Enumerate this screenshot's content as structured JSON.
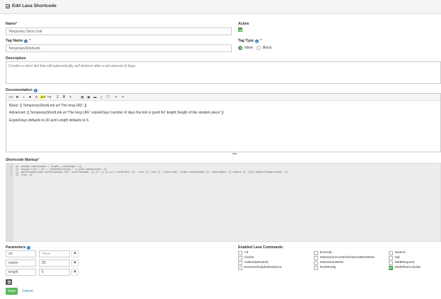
{
  "header": {
    "title": "Edit Lava Shortcode"
  },
  "name": {
    "label": "Name",
    "value": "Temporary Short Link"
  },
  "active": {
    "label": "Active",
    "checked": true
  },
  "tag_name": {
    "label": "Tag Name",
    "value": "TemporaryShortLink"
  },
  "tag_type": {
    "label": "Tag Type",
    "options": [
      "Inline",
      "Block"
    ],
    "selected": "Inline"
  },
  "description": {
    "label": "Description",
    "value": "Creates a short link that will automatically self destruct after a set amount of days."
  },
  "documentation": {
    "label": "Documentation",
    "toolbar": [
      "code-view-icon",
      "bold-icon",
      "italic-icon",
      "strikethrough-icon",
      "link-icon",
      "highlight-color-icon",
      "font-color-icon",
      "unordered-list-icon",
      "ordered-list-icon",
      "clear-format-icon",
      "table-icon",
      "image-icon",
      "folder-icon",
      "file-icon",
      "copy-icon",
      "undo-icon",
      "redo-icon"
    ],
    "lines": [
      "Basic: {[ TemporaryShortLink url:'The long URL' ]}",
      "Advanced: {[ TemporaryShortLink url:'The long URL' expireDays:'number of days the link is good for' length:'length of the random piece' ]}",
      "ExpireDays defaults to 30 and Length defaults to 5."
    ]
  },
  "markup": {
    "label": "Shortcode Markup",
    "line_numbers": [
      "1",
      "2",
      "3",
      "4"
    ],
    "lines": [
      "{%- assign tokenLength = length | AsInteger -%}",
      "{%- assign link = url | CreateShortLink:'',4,true,tokenLength -%}",
      "{{- workflowactivate workflowtype:'015' workflowname:'{{ url }} {{ url:'LocalPath' }}' link:'{{ link }}' linkstring | Right:tokenLength }}' expireDays:'{{ expire }}' %}{% endworkflowactivate -%}",
      "{{- link -}}"
    ]
  },
  "parameters": {
    "label": "Parameters",
    "rows": [
      {
        "key": "url",
        "value": "",
        "value_placeholder": "Value"
      },
      {
        "key": "expire",
        "value": "30",
        "value_placeholder": "Value"
      },
      {
        "key": "length",
        "value": "5",
        "value_placeholder": "Value"
      }
    ]
  },
  "commands": {
    "label": "Enabled Lava Commands",
    "col1": [
      {
        "name": "All",
        "checked": false
      },
      {
        "name": "Cache",
        "checked": false
      },
      {
        "name": "CalendarEvents",
        "checked": false
      },
      {
        "name": "EventScheduledInstance",
        "checked": false
      }
    ],
    "col2": [
      {
        "name": "Execute",
        "checked": false
      },
      {
        "name": "InteractionContentChannelItemWrite",
        "checked": false
      },
      {
        "name": "InteractionWrite",
        "checked": false
      },
      {
        "name": "RockEntity",
        "checked": false
      }
    ],
    "col3": [
      {
        "name": "Search",
        "checked": false
      },
      {
        "name": "Sql",
        "checked": false
      },
      {
        "name": "WebRequest",
        "checked": false
      },
      {
        "name": "WorkflowActivate",
        "checked": true
      }
    ]
  },
  "actions": {
    "save": "Save",
    "cancel": "Cancel"
  },
  "colors": {
    "accent": "#5cb85c",
    "link": "#337ab7",
    "required": "#c9302c"
  }
}
